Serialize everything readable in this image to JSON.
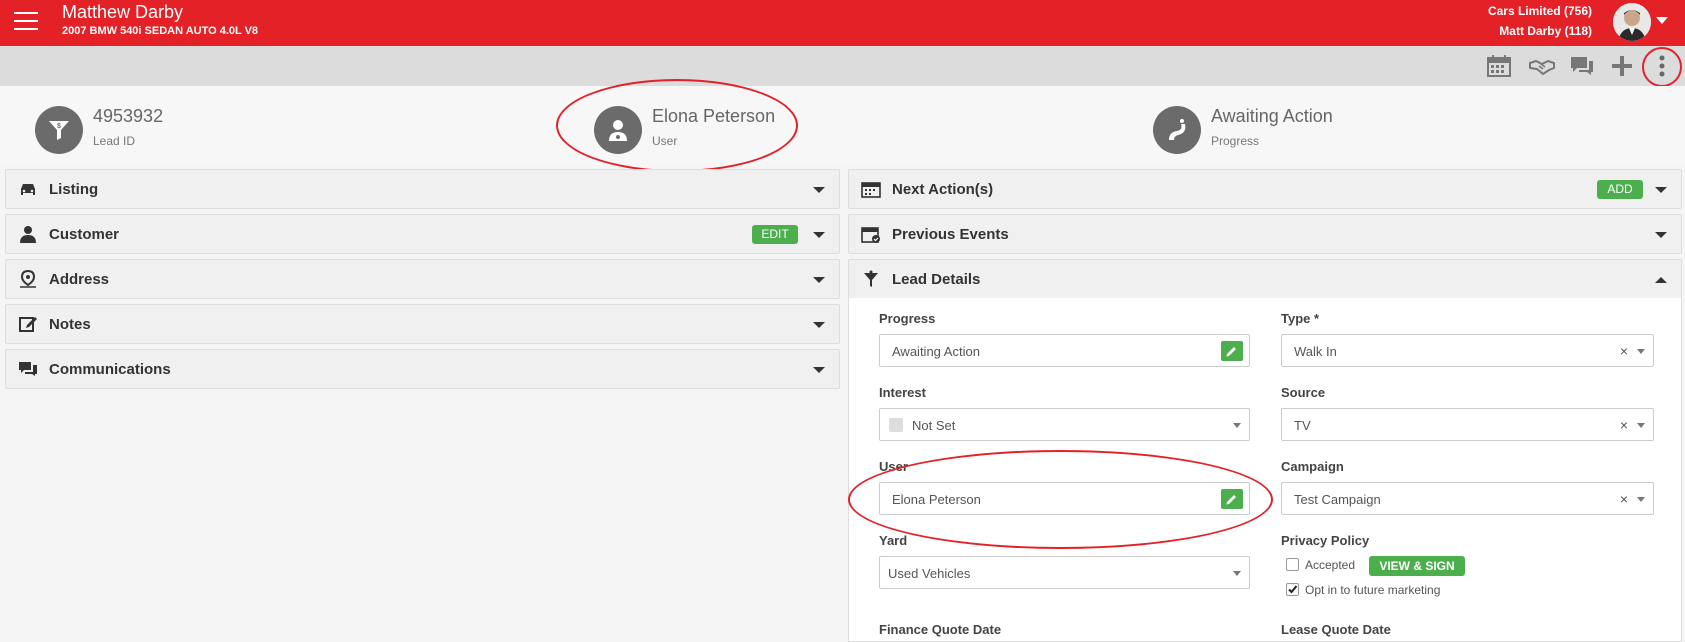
{
  "header": {
    "customer_name": "Matthew Darby",
    "vehicle": "2007 BMW 540i SEDAN AUTO 4.0L V8",
    "dealer": "Cars Limited (756)",
    "user": "Matt Darby (118)"
  },
  "toolbar": {
    "icons": [
      "calendar-icon",
      "handshake-icon",
      "chat-icon",
      "plus-icon",
      "more-vertical-icon"
    ]
  },
  "summary": {
    "lead_id": {
      "value": "4953932",
      "label": "Lead ID"
    },
    "user": {
      "value": "Elona Peterson",
      "label": "User"
    },
    "progress": {
      "value": "Awaiting Action",
      "label": "Progress"
    }
  },
  "left_panels": [
    {
      "label": "Listing",
      "icon": "car-icon"
    },
    {
      "label": "Customer",
      "icon": "person-icon",
      "action": "EDIT"
    },
    {
      "label": "Address",
      "icon": "location-icon"
    },
    {
      "label": "Notes",
      "icon": "edit-note-icon"
    },
    {
      "label": "Communications",
      "icon": "chat-icon"
    }
  ],
  "right_panels": [
    {
      "label": "Next Action(s)",
      "icon": "calendar-icon",
      "action": "ADD"
    },
    {
      "label": "Previous Events",
      "icon": "calendar-check-icon"
    },
    {
      "label": "Lead Details",
      "icon": "funnel-icon",
      "expanded": true
    }
  ],
  "lead_details": {
    "progress": {
      "label": "Progress",
      "value": "Awaiting Action"
    },
    "type": {
      "label": "Type *",
      "value": "Walk In"
    },
    "interest": {
      "label": "Interest",
      "value": "Not Set"
    },
    "source": {
      "label": "Source",
      "value": "TV"
    },
    "user": {
      "label": "User",
      "value": "Elona Peterson"
    },
    "campaign": {
      "label": "Campaign",
      "value": "Test Campaign"
    },
    "yard": {
      "label": "Yard",
      "value": "Used Vehicles"
    },
    "privacy": {
      "label": "Privacy Policy",
      "accepted_label": "Accepted",
      "accepted": false,
      "view_sign": "VIEW & SIGN",
      "opt_in_label": "Opt in to future marketing",
      "opt_in": true
    },
    "finance_quote_date": {
      "label": "Finance Quote Date"
    },
    "lease_quote_date": {
      "label": "Lease Quote Date"
    }
  },
  "colors": {
    "brand": "#e32127",
    "green": "#4cae4c"
  }
}
